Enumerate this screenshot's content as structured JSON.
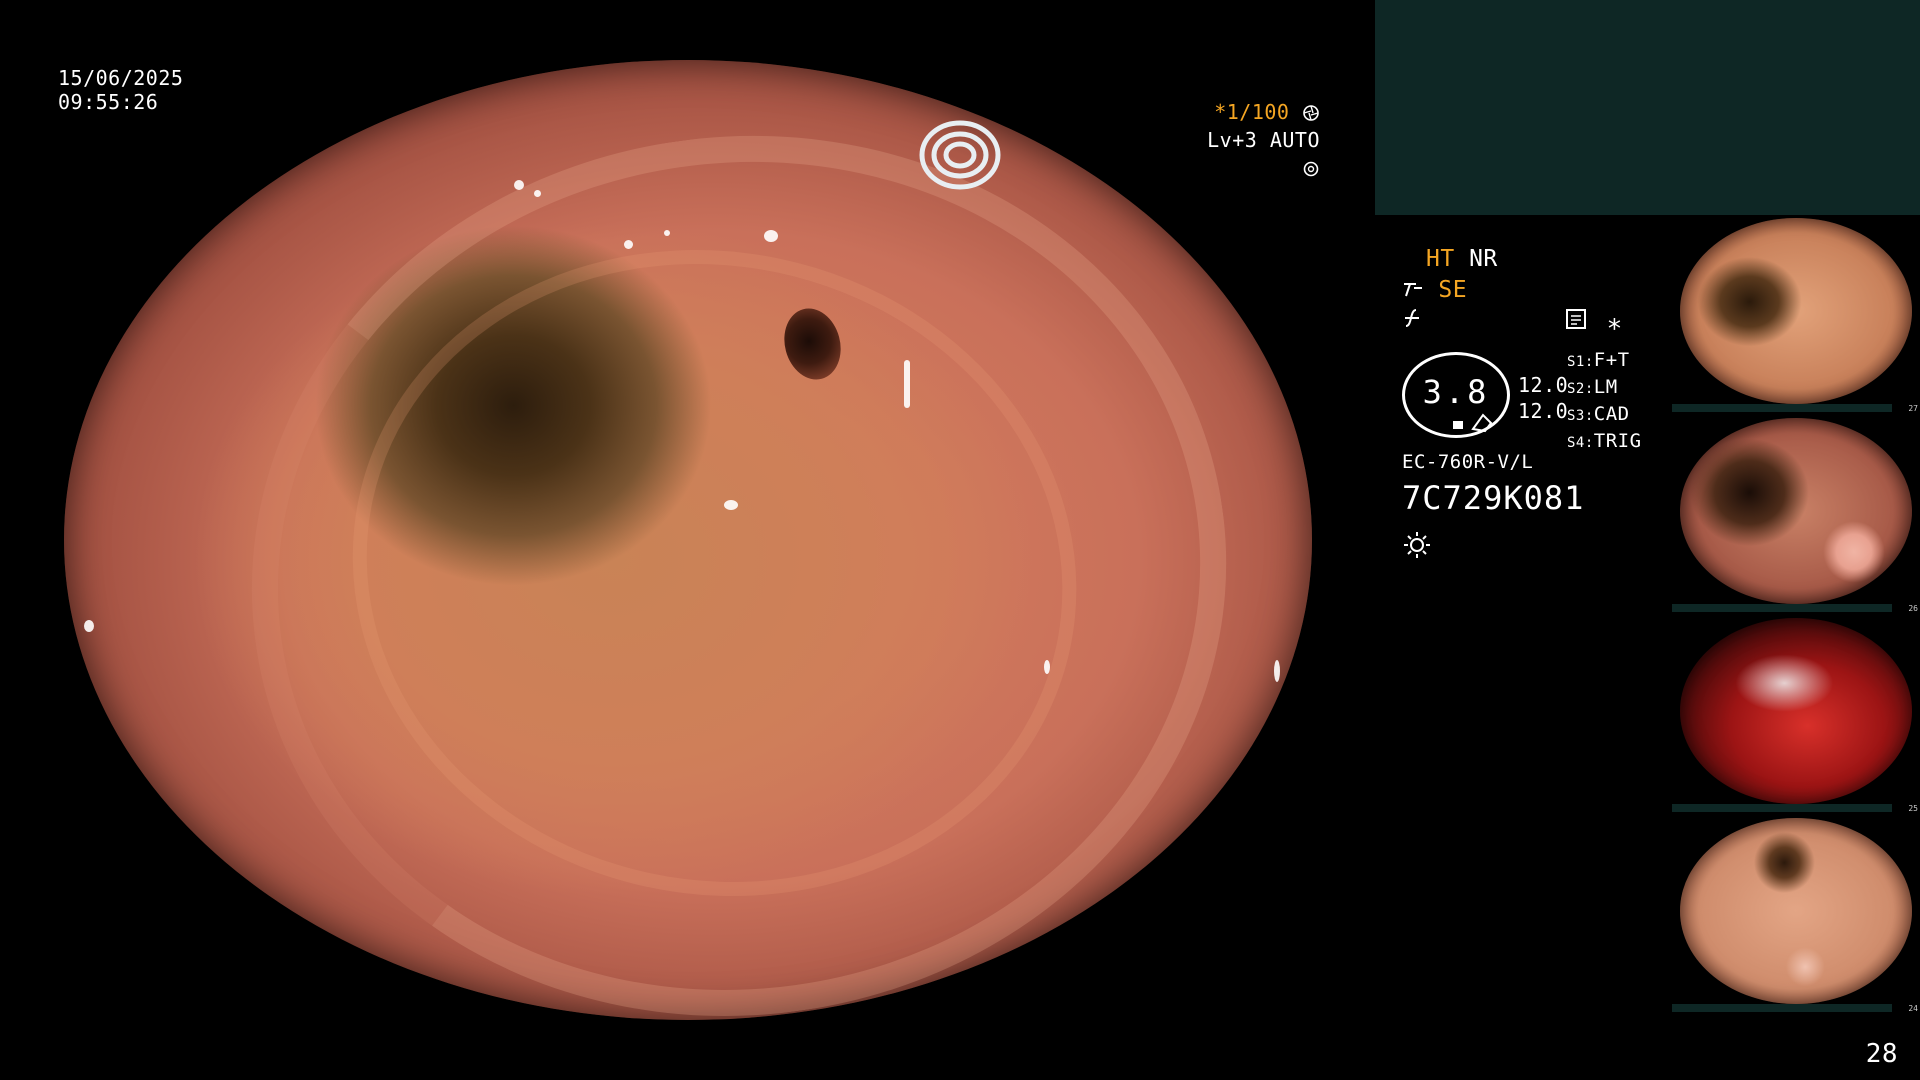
{
  "overlay": {
    "date": "15/06/2025",
    "time": "09:55:26",
    "shutter": "*1/100",
    "level": "Lv+3",
    "mode": "AUTO"
  },
  "settings": {
    "ht": "HT",
    "nr": "NR",
    "se": "SE"
  },
  "gauge": {
    "value": "3.8",
    "reading_1": "12.0",
    "reading_2": "12.0"
  },
  "switches": [
    {
      "key": "S1:",
      "value": "F+T"
    },
    {
      "key": "S2:",
      "value": "LM"
    },
    {
      "key": "S3:",
      "value": "CAD"
    },
    {
      "key": "S4:",
      "value": "TRIG"
    }
  ],
  "scope": {
    "model": "EC-760R-V/L",
    "serial": "7C729K081"
  },
  "thumbnails": [
    {
      "number": "27"
    },
    {
      "number": "26"
    },
    {
      "number": "25"
    },
    {
      "number": "24"
    }
  ],
  "page_number": "28",
  "icons": {
    "shutter": "aperture-icon",
    "mode": "gear-icon",
    "se": "se-icon",
    "enhance": "enhance-icon",
    "memo": "memo-icon",
    "star": "asterisk-icon",
    "light": "light-icon"
  },
  "colors": {
    "accent": "#f5a623",
    "panel": "#0e2725"
  }
}
